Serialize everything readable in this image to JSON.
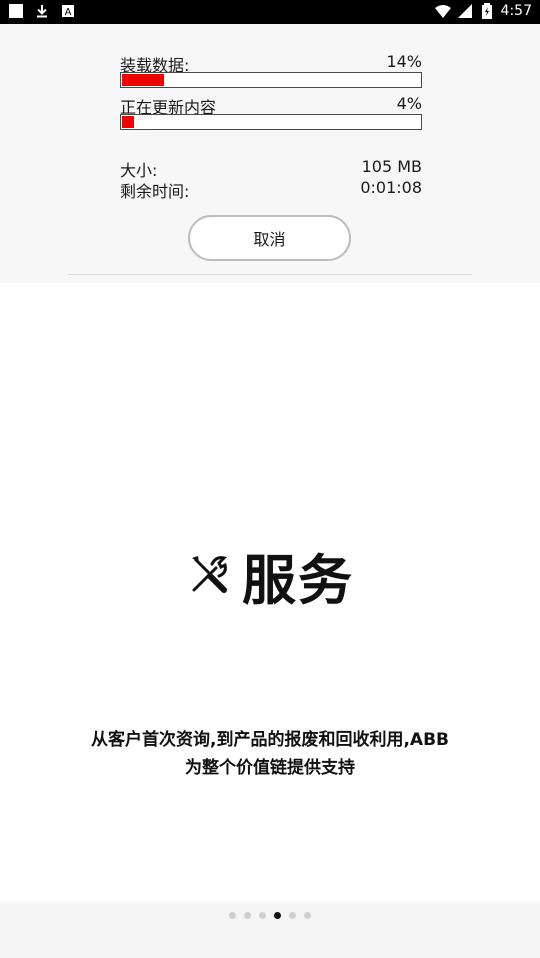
{
  "status_bar": {
    "time": "4:57",
    "left_icons": [
      "app-icon",
      "download-icon",
      "a-notification-icon"
    ],
    "right_icons": [
      "wifi-icon",
      "signal-icon",
      "battery-icon"
    ]
  },
  "download": {
    "loading_label": "装载数据:",
    "loading_percent": "14%",
    "loading_progress": 0.14,
    "updating_label": "正在更新内容",
    "updating_percent": "4%",
    "updating_progress": 0.04,
    "size_label": "大小:",
    "size_value": "105 MB",
    "time_label": "剩余时间:",
    "time_value": "0:01:08",
    "cancel_label": "取消",
    "accent_color": "#ee0000"
  },
  "slide": {
    "icon": "tools-icon",
    "title": "服务",
    "description_line1": "从客户首次资询,到产品的报废和回收利用,ABB",
    "description_line2": "为整个价值链提供支持"
  },
  "pager": {
    "count": 6,
    "active_index": 3
  }
}
